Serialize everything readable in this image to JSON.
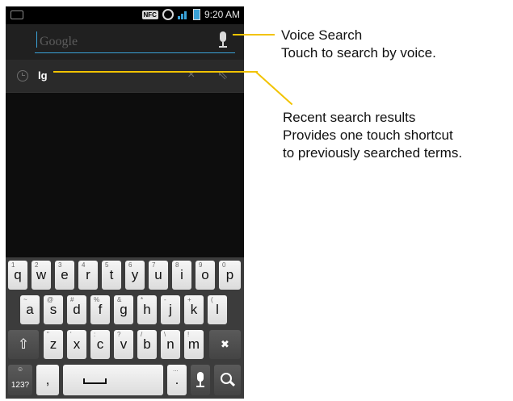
{
  "status_bar": {
    "nfc": "NFC",
    "time": "9:20 AM"
  },
  "search": {
    "placeholder": "Google",
    "value": ""
  },
  "suggestion": {
    "text": "lg",
    "clear_glyph": "×",
    "insert_glyph": "⇖"
  },
  "keyboard": {
    "row1": [
      {
        "label": "q",
        "hint": "1"
      },
      {
        "label": "w",
        "hint": "2"
      },
      {
        "label": "e",
        "hint": "3"
      },
      {
        "label": "r",
        "hint": "4"
      },
      {
        "label": "t",
        "hint": "5"
      },
      {
        "label": "y",
        "hint": "6"
      },
      {
        "label": "u",
        "hint": "7"
      },
      {
        "label": "i",
        "hint": "8"
      },
      {
        "label": "o",
        "hint": "9"
      },
      {
        "label": "p",
        "hint": "0"
      }
    ],
    "row2": [
      {
        "label": "a",
        "hint": "~"
      },
      {
        "label": "s",
        "hint": "@"
      },
      {
        "label": "d",
        "hint": "#"
      },
      {
        "label": "f",
        "hint": "%"
      },
      {
        "label": "g",
        "hint": "&"
      },
      {
        "label": "h",
        "hint": "*"
      },
      {
        "label": "j",
        "hint": "-"
      },
      {
        "label": "k",
        "hint": "+"
      },
      {
        "label": "l",
        "hint": "("
      }
    ],
    "row3": [
      {
        "label": "z",
        "hint": "\""
      },
      {
        "label": "x",
        "hint": "'"
      },
      {
        "label": "c",
        "hint": ":"
      },
      {
        "label": "v",
        "hint": "?"
      },
      {
        "label": "b",
        "hint": "/"
      },
      {
        "label": "n",
        "hint": "\\"
      },
      {
        "label": "m",
        "hint": "!"
      }
    ],
    "shift_glyph": "⇧",
    "backspace_glyph": "✖",
    "symbols_label": "123?",
    "symbols_hint": "☺",
    "comma_label": ",",
    "period_label": ".",
    "period_hint": "...",
    "search_glyph": "⚲"
  },
  "annotations": {
    "voice_title": "Voice Search",
    "voice_desc": "Touch to search by voice.",
    "recent_title": "Recent search results",
    "recent_line2": "Provides one touch shortcut",
    "recent_line3": "to previously searched terms."
  },
  "colors": {
    "accent": "#3aa2d8",
    "callout": "#f2c300",
    "key_light": "#eeeeee",
    "key_dark": "#4a4a4a"
  }
}
